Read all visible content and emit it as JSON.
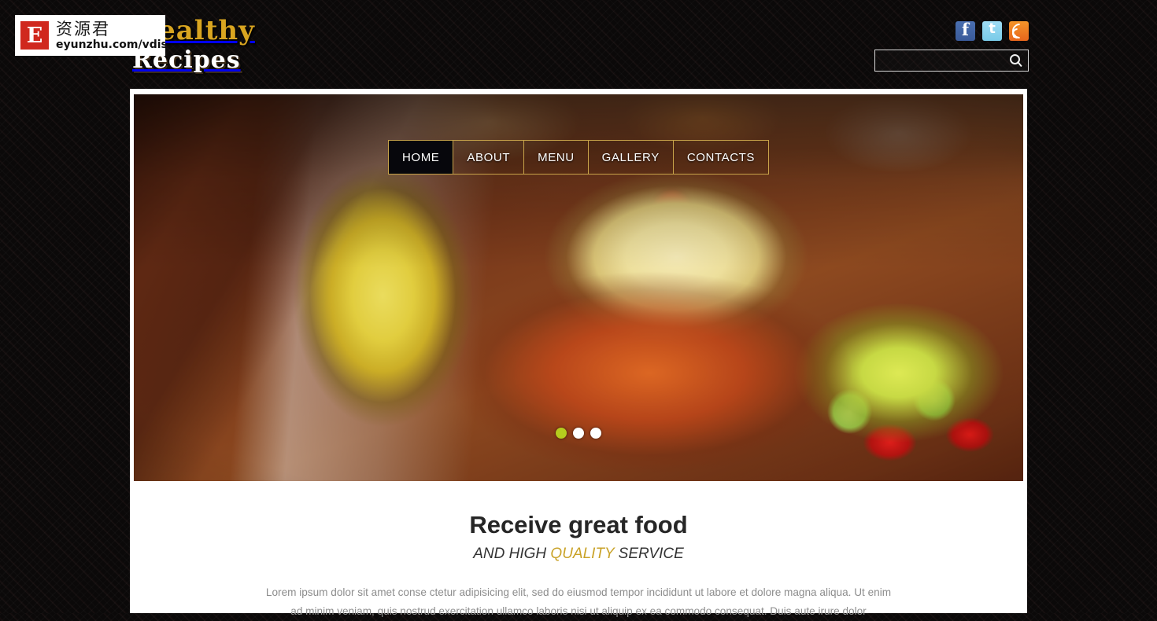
{
  "site": {
    "logo_line1": "Healthy",
    "logo_line2": "Recipes"
  },
  "header": {
    "social": [
      {
        "name": "facebook",
        "glyph": "f",
        "color": "#3a5a99",
        "label": "Facebook"
      },
      {
        "name": "twitter",
        "glyph": "t",
        "color": "#79cbe8",
        "label": "Twitter"
      },
      {
        "name": "rss",
        "glyph": "",
        "color": "#e8661c",
        "label": "RSS"
      }
    ],
    "search": {
      "value": "",
      "placeholder": "",
      "icon": "search-icon",
      "button_label": ""
    }
  },
  "nav": {
    "items": [
      {
        "label": "HOME",
        "active": true
      },
      {
        "label": "ABOUT",
        "active": false
      },
      {
        "label": "MENU",
        "active": false
      },
      {
        "label": "GALLERY",
        "active": false
      },
      {
        "label": "CONTACTS",
        "active": false
      }
    ],
    "border_color": "#c8a44a",
    "active_bg": "#07070c"
  },
  "slider": {
    "dots": [
      {
        "active": true
      },
      {
        "active": false
      },
      {
        "active": false
      }
    ],
    "active_dot_color": "#b5cc1e",
    "slide_alt": "Table with pineapple, pasta salad bowl and fresh vegetable salad"
  },
  "content": {
    "heading": "Receive great food",
    "subtitle_pre": "AND HIGH ",
    "subtitle_highlight": "QUALITY",
    "subtitle_post": " SERVICE",
    "highlight_color": "#c9a227",
    "paragraph": "Lorem ipsum dolor sit amet conse ctetur adipisicing elit, sed do eiusmod tempor incididunt ut labore et dolore magna aliqua. Ut enim ad minim veniam, quis nostrud exercitation ullamco laboris nisi ut aliquip ex ea commodo consequat. Duis aute irure dolor"
  },
  "watermark": {
    "badge_letter": "E",
    "cn_text": "资源君",
    "url_text": "eyunzhu.com/vdisk",
    "badge_color": "#d0281e"
  }
}
